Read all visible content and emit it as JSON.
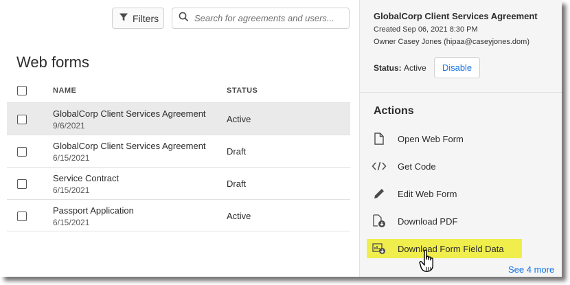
{
  "toolbar": {
    "filters_label": "Filters",
    "search_placeholder": "Search for agreements and users..."
  },
  "list": {
    "title": "Web forms",
    "columns": {
      "name": "NAME",
      "status": "STATUS"
    },
    "rows": [
      {
        "name": "GlobalCorp Client Services Agreement",
        "date": "9/6/2021",
        "status": "Active",
        "selected": true
      },
      {
        "name": "GlobalCorp Client Services Agreement",
        "date": "6/15/2021",
        "status": "Draft",
        "selected": false
      },
      {
        "name": "Service Contract",
        "date": "6/15/2021",
        "status": "Draft",
        "selected": false
      },
      {
        "name": "Passport Application",
        "date": "6/15/2021",
        "status": "Active",
        "selected": false
      }
    ]
  },
  "panel": {
    "title": "GlobalCorp Client Services Agreement",
    "created": "Created Sep 06, 2021 8:30 PM",
    "owner": "Owner Casey Jones (hipaa@caseyjones.dom)",
    "status_label": "Status:",
    "status_value": "Active",
    "disable_label": "Disable",
    "actions_title": "Actions",
    "actions": [
      {
        "label": "Open Web Form",
        "icon": "document-icon"
      },
      {
        "label": "Get Code",
        "icon": "code-icon"
      },
      {
        "label": "Edit Web Form",
        "icon": "pencil-icon"
      },
      {
        "label": "Download PDF",
        "icon": "download-pdf-icon"
      },
      {
        "label": "Download Form Field Data",
        "icon": "download-data-icon",
        "highlighted": true
      }
    ],
    "see_more": "See 4 more"
  },
  "colors": {
    "accent": "#1473e6",
    "highlight": "#f0ee4c",
    "selected_row": "#eaeaea",
    "panel_bg": "#f5f5f5"
  }
}
